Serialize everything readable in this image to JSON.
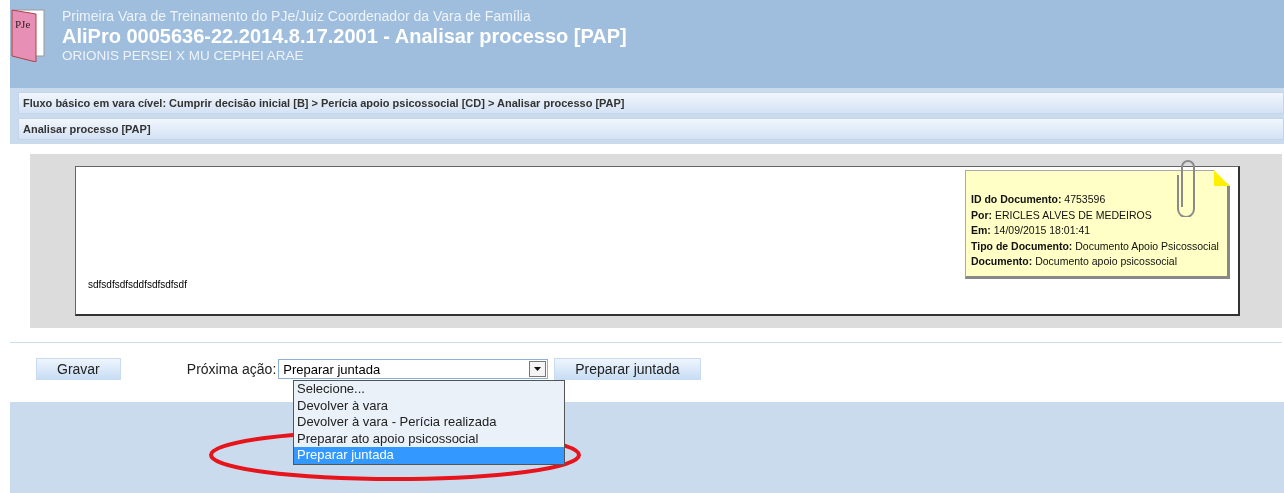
{
  "header": {
    "court": "Primeira Vara de Treinamento do PJe/Juiz Coordenador da Vara de Família",
    "title": "AliPro 0005636-22.2014.8.17.2001 - Analisar processo [PAP]",
    "parties": "ORIONIS PERSEI X MU CEPHEI ARAE",
    "logo_text": "PJe"
  },
  "breadcrumb": "Fluxo básico em vara cível: Cumprir decisão inicial [B] > Perícia apoio psicossocial [CD] > Analisar processo [PAP]",
  "task_title": "Analisar processo [PAP]",
  "document": {
    "body": "sdfsdfsdfsddfsdfsdfsdf",
    "note": [
      {
        "label": "ID do Documento:",
        "value": "4753596"
      },
      {
        "label": "Por:",
        "value": "ERICLES ALVES DE MEDEIROS"
      },
      {
        "label": "Em:",
        "value": "14/09/2015 18:01:41"
      },
      {
        "label": "Tipo de Documento:",
        "value": "Documento Apoio Psicossocial"
      },
      {
        "label": "Documento:",
        "value": "Documento apoio psicossocial"
      }
    ]
  },
  "actions": {
    "save_button": "Gravar",
    "next_label": "Próxima ação:",
    "select_value": "Preparar juntada",
    "submit_button": "Preparar juntada",
    "options": [
      {
        "label": "Selecione...",
        "selected": false
      },
      {
        "label": "Devolver à vara",
        "selected": false
      },
      {
        "label": "Devolver à vara - Perícia realizada",
        "selected": false
      },
      {
        "label": "Preparar ato apoio psicossocial",
        "selected": false
      },
      {
        "label": "Preparar juntada",
        "selected": true
      }
    ]
  },
  "annotation": {
    "kind": "ellipse",
    "color": "#e8141c"
  }
}
